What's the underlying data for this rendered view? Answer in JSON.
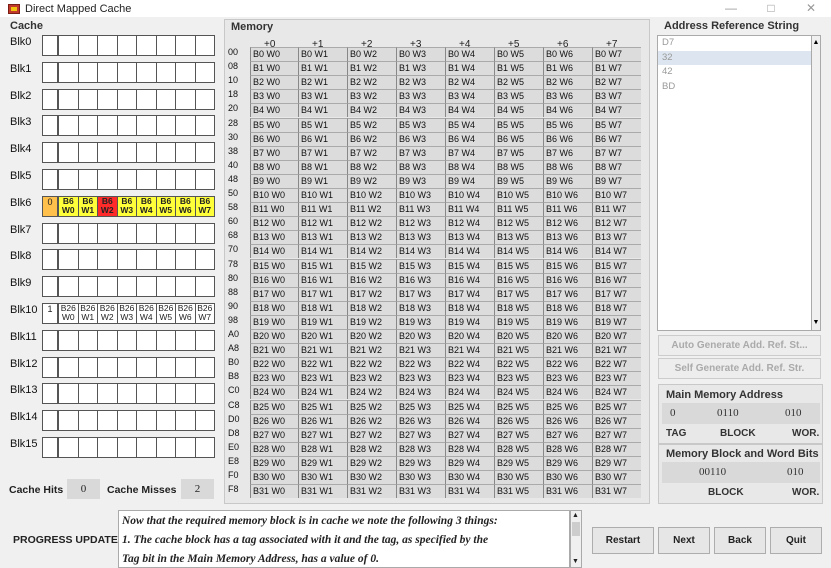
{
  "window": {
    "title": "Direct Mapped Cache",
    "buttons": [
      "—",
      "□",
      "✕"
    ]
  },
  "cache": {
    "title": "Cache",
    "blocks": [
      {
        "label": "Blk0",
        "tag": "",
        "words": []
      },
      {
        "label": "Blk1",
        "tag": "",
        "words": []
      },
      {
        "label": "Blk2",
        "tag": "",
        "words": []
      },
      {
        "label": "Blk3",
        "tag": "",
        "words": []
      },
      {
        "label": "Blk4",
        "tag": "",
        "words": []
      },
      {
        "label": "Blk5",
        "tag": "",
        "words": []
      },
      {
        "label": "Blk6",
        "tag": "0",
        "words": [
          "B6 W0",
          "B6 W1",
          "B6 W2",
          "B6 W3",
          "B6 W4",
          "B6 W5",
          "B6 W6",
          "B6 W7"
        ],
        "highlight": 2
      },
      {
        "label": "Blk7",
        "tag": "",
        "words": []
      },
      {
        "label": "Blk8",
        "tag": "",
        "words": []
      },
      {
        "label": "Blk9",
        "tag": "",
        "words": []
      },
      {
        "label": "Blk10",
        "tag": "1",
        "words": [
          "B26 W0",
          "B26 W1",
          "B26 W2",
          "B26 W3",
          "B26 W4",
          "B26 W5",
          "B26 W6",
          "B26 W7"
        ]
      },
      {
        "label": "Blk11",
        "tag": "",
        "words": []
      },
      {
        "label": "Blk12",
        "tag": "",
        "words": []
      },
      {
        "label": "Blk13",
        "tag": "",
        "words": []
      },
      {
        "label": "Blk14",
        "tag": "",
        "words": []
      },
      {
        "label": "Blk15",
        "tag": "",
        "words": []
      }
    ],
    "hits_label": "Cache Hits",
    "hits": "0",
    "misses_label": "Cache Misses",
    "misses": "2"
  },
  "memory": {
    "title": "Memory",
    "offsets": [
      "+0",
      "+1",
      "+2",
      "+3",
      "+4",
      "+5",
      "+6",
      "+7"
    ],
    "addresses": [
      "00",
      "08",
      "10",
      "18",
      "20",
      "28",
      "30",
      "38",
      "40",
      "48",
      "50",
      "58",
      "60",
      "68",
      "70",
      "78",
      "80",
      "88",
      "90",
      "98",
      "A0",
      "A8",
      "B0",
      "B8",
      "C0",
      "C8",
      "D0",
      "D8",
      "E0",
      "E8",
      "F0",
      "F8"
    ]
  },
  "address_ref": {
    "title": "Address Reference String",
    "items": [
      "D7",
      "32",
      "42",
      "BD"
    ],
    "selected_index": 1,
    "auto_button": "Auto Generate Add. Ref. St...",
    "self_button": "Self Generate Add. Ref. Str."
  },
  "main_memory_address": {
    "title": "Main Memory Address",
    "tag_value": "0",
    "block_value": "0110",
    "word_value": "010",
    "tag_label": "TAG",
    "block_label": "BLOCK",
    "word_label": "WOR."
  },
  "memory_block_word": {
    "title": "Memory Block and Word Bits",
    "block_value": "00110",
    "word_value": "010",
    "block_label": "BLOCK",
    "word_label": "WOR."
  },
  "progress": {
    "label": "PROGRESS UPDATE",
    "lines": [
      "Now that the required memory block is in cache we note the following 3 things:",
      "1. The cache block has a tag associated with it and the tag, as specified by the",
      "Tag bit in the Main Memory Address, has a value of 0."
    ]
  },
  "controls": {
    "restart": "Restart",
    "next": "Next",
    "back": "Back",
    "quit": "Quit"
  }
}
